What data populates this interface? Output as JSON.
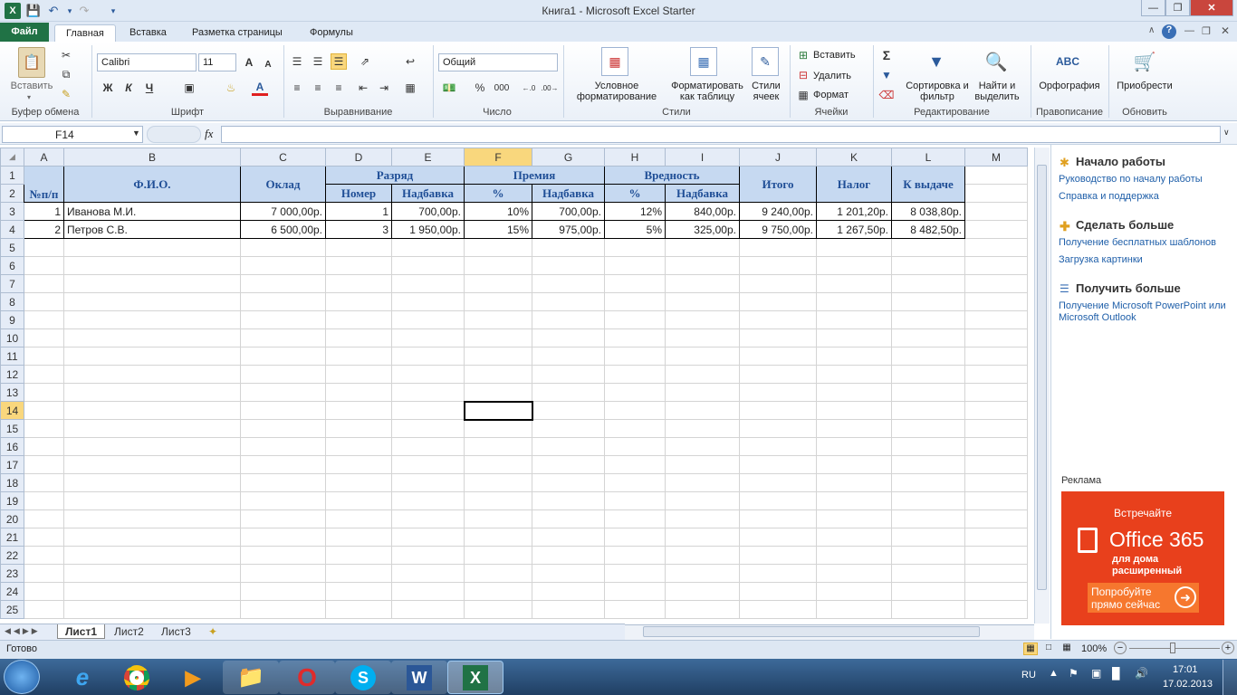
{
  "window": {
    "title": "Книга1  -  Microsoft Excel Starter"
  },
  "tabs": {
    "file": "Файл",
    "home": "Главная",
    "insert": "Вставка",
    "layout": "Разметка страницы",
    "formulas": "Формулы"
  },
  "ribbon": {
    "clipboard": {
      "paste": "Вставить",
      "label": "Буфер обмена"
    },
    "font": {
      "name": "Calibri",
      "size": "11",
      "bold": "Ж",
      "italic": "К",
      "underline": "Ч",
      "grow": "A",
      "shrink": "A",
      "label": "Шрифт"
    },
    "align": {
      "label": "Выравнивание"
    },
    "number": {
      "format": "Общий",
      "percent": "%",
      "thousands": "000",
      "label": "Число"
    },
    "styles": {
      "conditional": "Условное форматирование",
      "table": "Форматировать как таблицу",
      "cell": "Стили ячеек",
      "label": "Стили"
    },
    "cells": {
      "insert": "Вставить",
      "delete": "Удалить",
      "format": "Формат",
      "label": "Ячейки"
    },
    "editing": {
      "sum": "Σ",
      "sort": "Сортировка и фильтр",
      "find": "Найти и выделить",
      "label": "Редактирование"
    },
    "proof": {
      "spelling": "Орфография",
      "abc": "ABC",
      "label": "Правописание"
    },
    "update": {
      "buy": "Приобрести",
      "label": "Обновить"
    }
  },
  "formula_bar": {
    "name_box": "F14",
    "fx": "fx",
    "formula": ""
  },
  "columns": [
    "A",
    "B",
    "C",
    "D",
    "E",
    "F",
    "G",
    "H",
    "I",
    "J",
    "K",
    "L",
    "M"
  ],
  "sheet_header": {
    "r1": {
      "num": "№п/п",
      "fio": "Ф.И.О.",
      "oklad": "Оклад",
      "razryad": "Разряд",
      "premiya": "Премия",
      "vrednost": "Вредность",
      "itogo": "Итого",
      "nalog": "Налог",
      "vydacha": "К выдаче"
    },
    "r2": {
      "nomer": "Номер",
      "nadbavka1": "Надбавка",
      "pct1": "%",
      "nadbavka2": "Надбавка",
      "pct2": "%",
      "nadbavka3": "Надбавка"
    }
  },
  "rows": [
    {
      "n": "1",
      "fio": "Иванова М.И.",
      "oklad": "7 000,00р.",
      "nomer": "1",
      "nadb": "700,00р.",
      "prem_pct": "10%",
      "prem": "700,00р.",
      "vr_pct": "12%",
      "vr": "840,00р.",
      "itogo": "9 240,00р.",
      "nalog": "1 201,20р.",
      "vydacha": "8 038,80р."
    },
    {
      "n": "2",
      "fio": "Петров С.В.",
      "oklad": "6 500,00р.",
      "nomer": "3",
      "nadb": "1 950,00р.",
      "prem_pct": "15%",
      "prem": "975,00р.",
      "vr_pct": "5%",
      "vr": "325,00р.",
      "itogo": "9 750,00р.",
      "nalog": "1 267,50р.",
      "vydacha": "8 482,50р."
    }
  ],
  "row_numbers": [
    "1",
    "2",
    "3",
    "4",
    "5",
    "6",
    "7",
    "8",
    "9",
    "10",
    "11",
    "12",
    "13",
    "14",
    "15",
    "16",
    "17",
    "18",
    "19",
    "20",
    "21",
    "22",
    "23",
    "24",
    "25"
  ],
  "sheets": [
    "Лист1",
    "Лист2",
    "Лист3"
  ],
  "pane": {
    "s1": {
      "title": "Начало работы",
      "links": [
        "Руководство по началу работы",
        "Справка и поддержка"
      ]
    },
    "s2": {
      "title": "Сделать больше",
      "links": [
        "Получение бесплатных шаблонов",
        "Загрузка картинки"
      ]
    },
    "s3": {
      "title": "Получить больше",
      "links": [
        "Получение Microsoft PowerPoint или Microsoft Outlook"
      ]
    },
    "ad_label": "Реклама",
    "ad": {
      "meet": "Встречайте",
      "brand": "Office 365",
      "line1": "для дома",
      "line2": "расширенный",
      "cta1": "Попробуйте",
      "cta2": "прямо сейчас"
    }
  },
  "status": {
    "ready": "Готово",
    "zoom": "100%"
  },
  "taskbar": {
    "lang": "RU",
    "time": "17:01",
    "date": "17.02.2013"
  },
  "colors": {
    "file_tab": "#207245",
    "header_fill": "#c6d9f1",
    "header_text": "#1f4e96",
    "ad": "#e8401c"
  }
}
